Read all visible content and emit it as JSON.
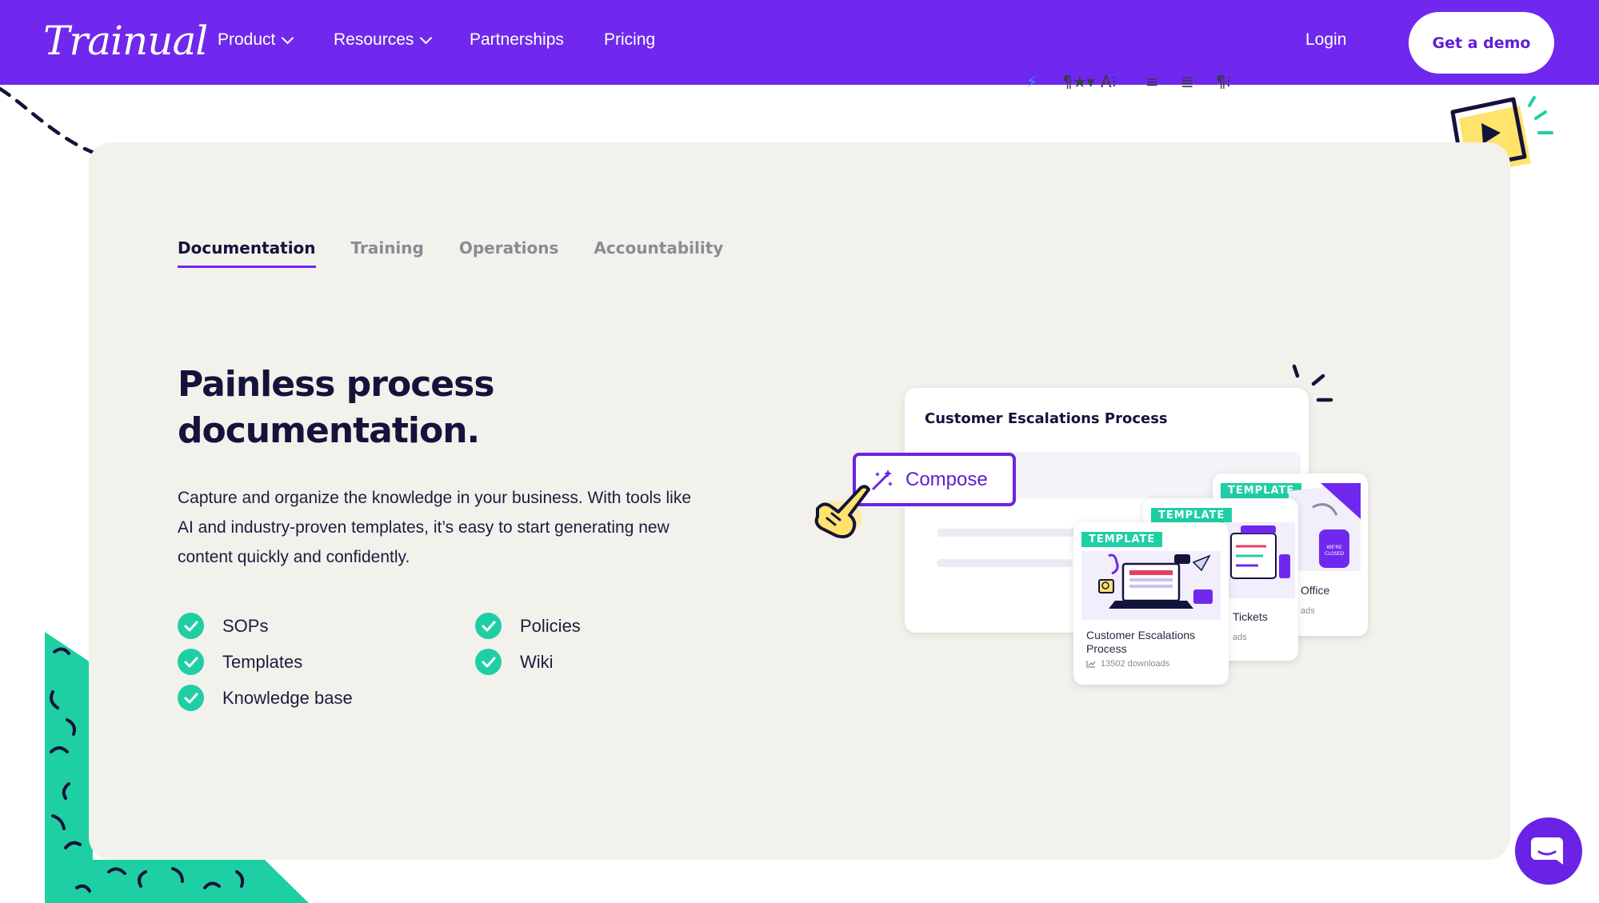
{
  "header": {
    "logo": "Trainual",
    "nav": [
      {
        "label": "Product",
        "has_dropdown": true
      },
      {
        "label": "Resources",
        "has_dropdown": true
      },
      {
        "label": "Partnerships",
        "has_dropdown": false
      },
      {
        "label": "Pricing",
        "has_dropdown": false
      }
    ],
    "login_label": "Login",
    "demo_label": "Get a demo"
  },
  "tabs": [
    {
      "label": "Documentation",
      "active": true
    },
    {
      "label": "Training",
      "active": false
    },
    {
      "label": "Operations",
      "active": false
    },
    {
      "label": "Accountability",
      "active": false
    }
  ],
  "hero": {
    "headline_line1": "Painless process",
    "headline_line2": "documentation.",
    "body": "Capture and organize the knowledge in your business. With tools like AI and industry-proven templates, it’s easy to start generating new content quickly and confidently."
  },
  "features": [
    {
      "label": "SOPs"
    },
    {
      "label": "Policies"
    },
    {
      "label": "Templates"
    },
    {
      "label": "Wiki"
    },
    {
      "label": "Knowledge base"
    }
  ],
  "illustration": {
    "doc_title": "Customer Escalations Process",
    "compose_label": "Compose",
    "toolbar_glyphs": [
      "⚡",
      "¶★▾",
      "A⁝",
      "≡",
      "≣",
      "¶⁝"
    ],
    "templates": [
      {
        "badge": "TEMPLATE",
        "name_line1": "Customer Escalations",
        "name_line2": "Process",
        "downloads": "13502 downloads"
      },
      {
        "badge": "TEMPLATE",
        "name_partial": "Tickets",
        "downloads_partial": "ads"
      },
      {
        "badge": "TEMPLATE",
        "name_partial": "Office",
        "downloads_partial": "ads",
        "sign_text": "SORRY WE'RE CLOSED"
      }
    ]
  },
  "colors": {
    "brand_purple": "#7028ee",
    "accent_teal": "#1fcfa4",
    "card_bg": "#f3f1ec",
    "heading": "#14133b"
  },
  "icons": [
    "chevron-down-icon",
    "check-icon",
    "magic-wand-icon",
    "pointer-hand-icon",
    "video-bubble-icon",
    "chat-icon"
  ]
}
